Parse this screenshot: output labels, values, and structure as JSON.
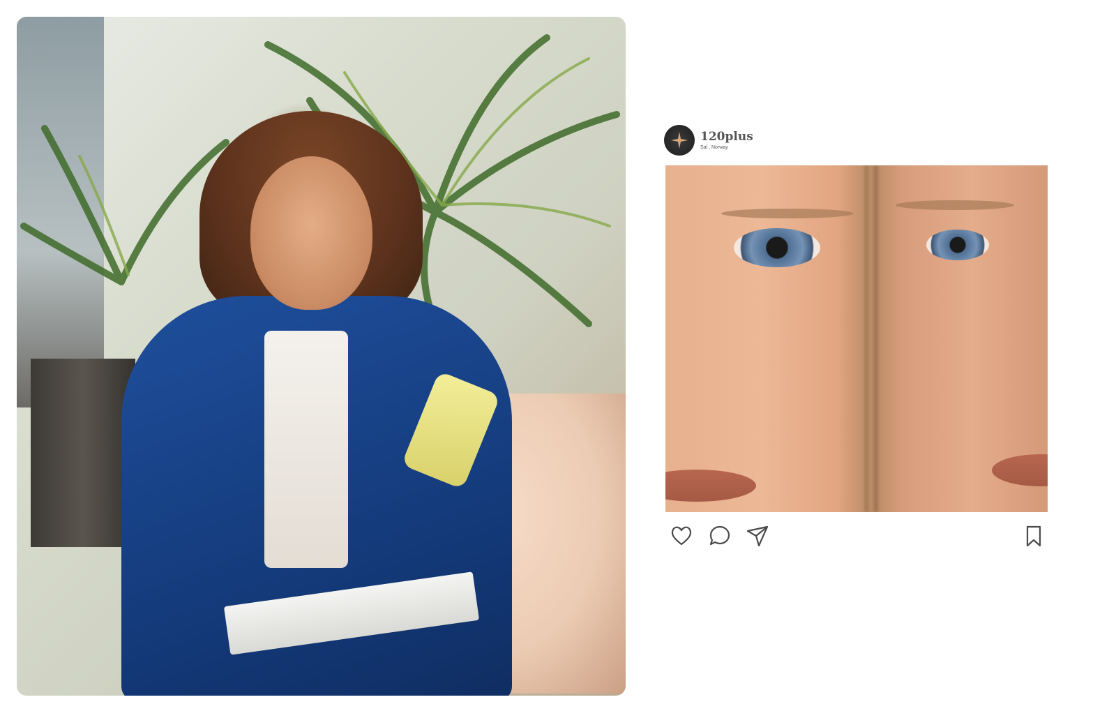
{
  "left_photo": {
    "description_icon": "woman-with-phone-photo"
  },
  "post": {
    "handle": "120plus",
    "location": "Sal , Norway",
    "image_icon": "two-faces-photo",
    "actions": {
      "like_icon": "heart-icon",
      "comment_icon": "comment-icon",
      "share_icon": "send-icon",
      "save_icon": "bookmark-icon"
    }
  },
  "colors": {
    "avatar_bg": "#1e1e1e",
    "avatar_star": "#d9a77a",
    "icon_stroke": "#4a4a4a",
    "handle_text": "#555555"
  }
}
